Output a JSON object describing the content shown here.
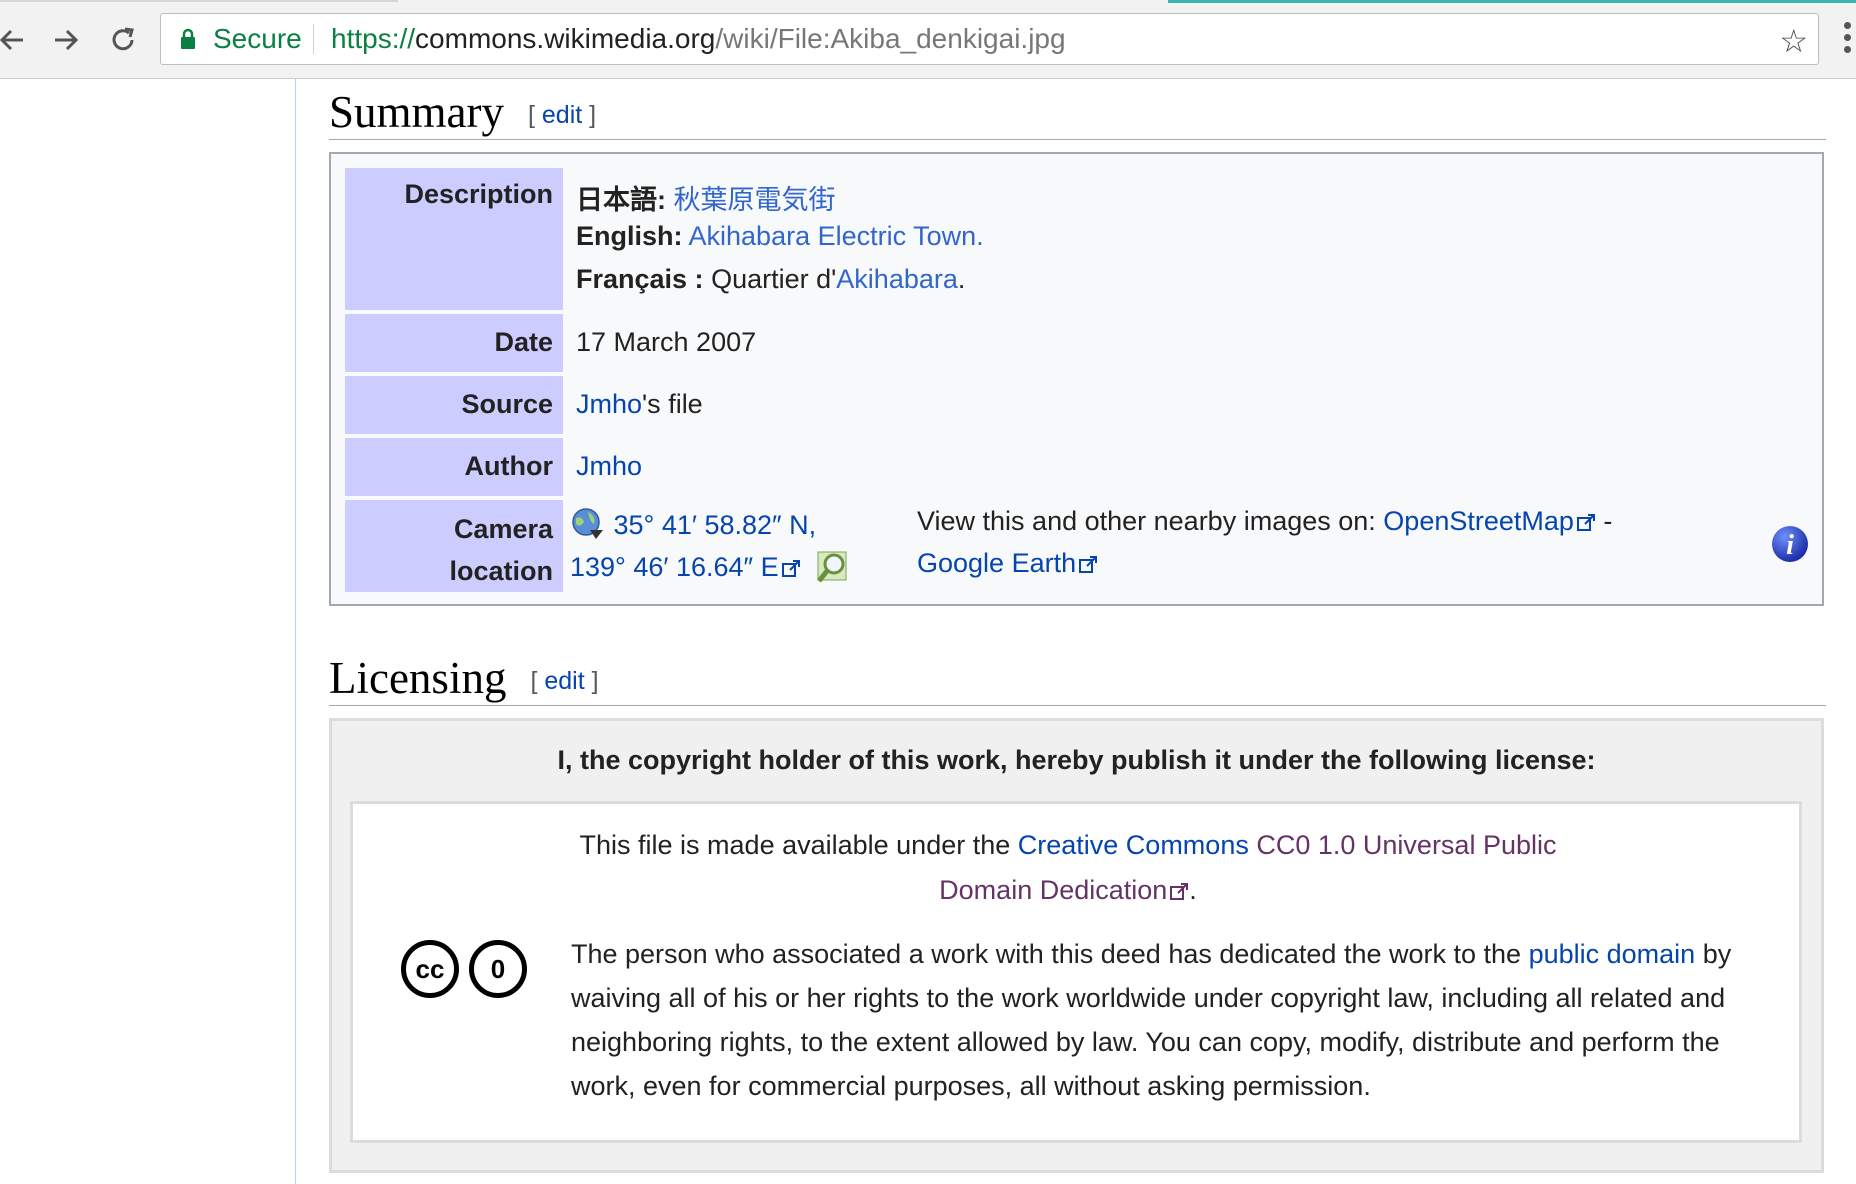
{
  "browser": {
    "secure_label": "Secure",
    "url_scheme": "https://",
    "url_host": "commons.wikimedia.org",
    "url_path": "/wiki/File:Akiba_denkigai.jpg"
  },
  "summary": {
    "heading": "Summary",
    "edit_open": "[",
    "edit_label": "edit",
    "edit_close": "]",
    "rows": {
      "description": {
        "label": "Description",
        "ja_lang": "日本語:",
        "ja_text": "秋葉原電気街",
        "en_lang": "English:",
        "en_text": "Akihabara Electric Town.",
        "fr_lang": "Français :",
        "fr_prefix": "Quartier d'",
        "fr_link": "Akihabara",
        "fr_suffix": "."
      },
      "date": {
        "label": "Date",
        "value": "17 March 2007"
      },
      "source": {
        "label": "Source",
        "link": "Jmho",
        "suffix": "'s file"
      },
      "author": {
        "label": "Author",
        "link": "Jmho"
      },
      "camera": {
        "label_line1": "Camera",
        "label_line2": "location",
        "coord_line1": "35° 41′ 58.82″ N,",
        "coord_line2": "139° 46′ 16.64″ E",
        "nearby_text": "View this and other nearby images on:",
        "osm_link": "OpenStreetMap",
        "dash": "-",
        "ge_link": "Google Earth"
      }
    }
  },
  "licensing": {
    "heading": "Licensing",
    "edit_open": "[",
    "edit_label": "edit",
    "edit_close": "]",
    "header": "I, the copyright holder of this work, hereby publish it under the following license:",
    "p1_prefix": "This file is made available under the",
    "p1_link_a": "Creative Commons",
    "p1_link_b": "CC0 1.0 Universal Public Domain Dedication",
    "p1_suffix": ".",
    "p2_before": "The person who associated a work with this deed has dedicated the work to the",
    "p2_link": "public domain",
    "p2_after": "by waiving all of his or her rights to the work worldwide under copyright law, including all related and neighboring rights, to the extent allowed by law. You can copy, modify, distribute and perform the work, even for commercial purposes, all without asking permission.",
    "cc_label": "cc",
    "zero_label": "0"
  },
  "colors": {
    "link": "#0645ad",
    "visited": "#663366",
    "label_bg": "#ccccff",
    "secure_green": "#0b8043"
  }
}
